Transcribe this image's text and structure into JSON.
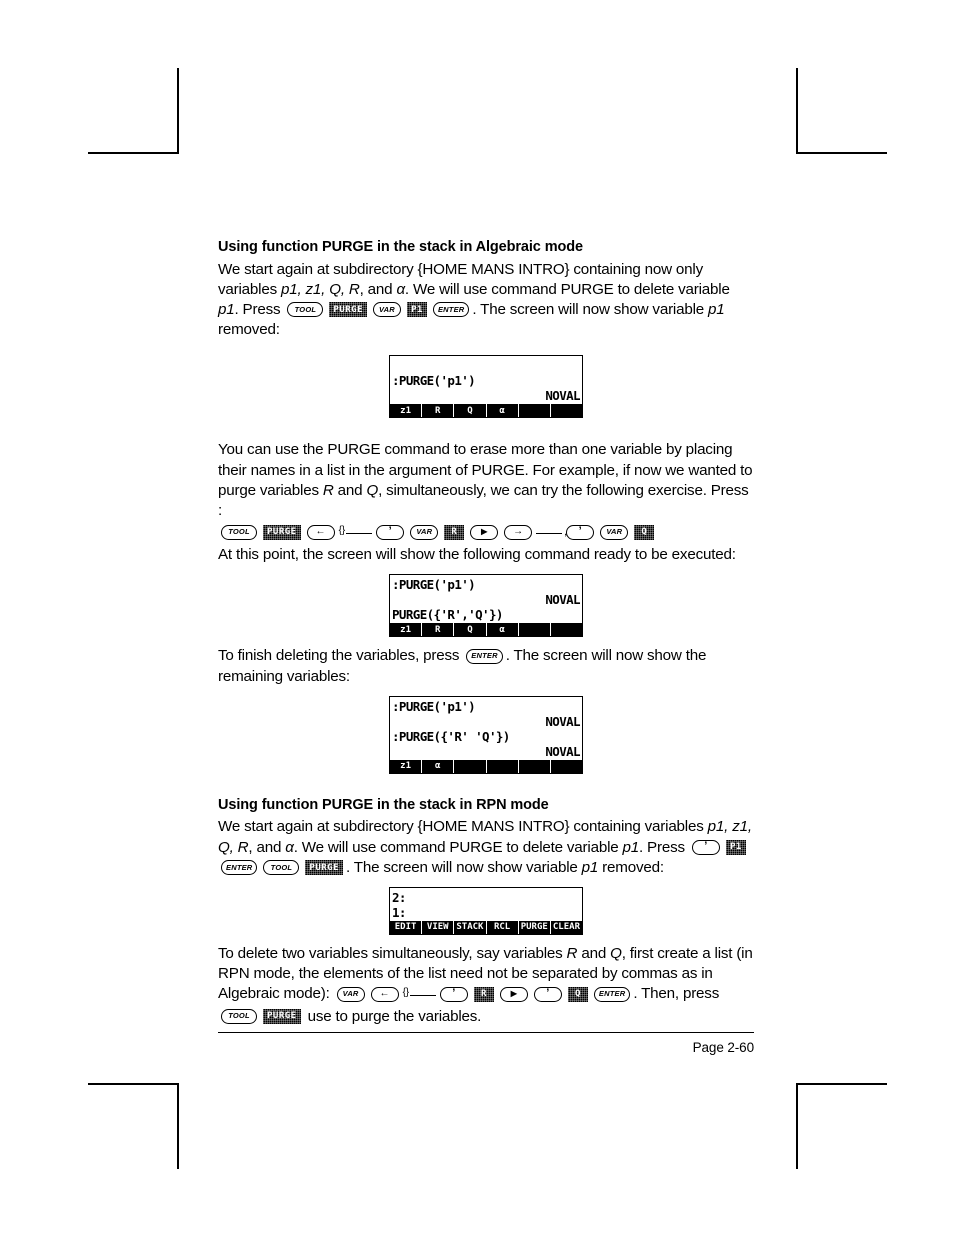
{
  "page": {
    "footer_label": "Page 2-60"
  },
  "sections": {
    "algebraic": {
      "heading": "Using function PURGE in the stack in Algebraic mode",
      "p1_a": "We start again at subdirectory {HOME MANS INTRO} containing now only variables ",
      "p1_vars": "p1, z1, Q, R",
      "p1_b": ", and ",
      "p1_alpha": "α",
      "p1_c": ".  We will use command PURGE to delete variable ",
      "p1_var": "p1",
      "p1_d": ".   Press ",
      "p1_e": ".   The screen will now show variable ",
      "p1_var2": "p1",
      "p1_f": " removed:",
      "keys1": [
        {
          "type": "key",
          "label": "TOOL",
          "name": "tool-key"
        },
        {
          "type": "softkey",
          "label": "PURGE",
          "name": "purge-softkey"
        },
        {
          "type": "key",
          "label": "VAR",
          "name": "var-key"
        },
        {
          "type": "softkey",
          "label": "P1",
          "name": "p1-softkey"
        },
        {
          "type": "key",
          "label": "ENTER",
          "name": "enter-key"
        }
      ],
      "p2_a": "You can use the PURGE command to erase more than one variable by placing their names in a list in the argument of PURGE.  For example, if now we wanted to purge variables ",
      "p2_R": "R",
      "p2_b": " and ",
      "p2_Q": "Q",
      "p2_c": ", simultaneously, we can try the following exercise.  Press :",
      "keys2": [
        {
          "type": "key",
          "label": "TOOL",
          "name": "tool-key"
        },
        {
          "type": "softkey",
          "label": "PURGE",
          "name": "purge-softkey"
        },
        {
          "type": "arrowkey",
          "label": "left-arrow",
          "name": "left-shift-key",
          "annot": "{}"
        },
        {
          "type": "key",
          "label": "'",
          "name": "tick-key"
        },
        {
          "type": "key",
          "label": "VAR",
          "name": "var-key"
        },
        {
          "type": "softkey",
          "label": "R",
          "name": "r-softkey"
        },
        {
          "type": "arrowkey",
          "label": "right-triangle",
          "name": "right-cursor-key"
        },
        {
          "type": "arrowkey",
          "label": "right-arrow",
          "name": "right-shift-key",
          "annot": ","
        },
        {
          "type": "key",
          "label": "'",
          "name": "tick-key"
        },
        {
          "type": "key",
          "label": "VAR",
          "name": "var-key"
        },
        {
          "type": "softkey",
          "label": "Q",
          "name": "q-softkey"
        }
      ],
      "p3": "At this point, the screen will show the following command ready to be executed:",
      "p4_a": "To finish deleting the variables, press ",
      "p4_enter": "ENTER",
      "p4_b": ".   The screen will now show the remaining variables:"
    },
    "rpn": {
      "heading": "Using function PURGE in the stack in RPN mode",
      "p1_a": "We start again at subdirectory {HOME MANS INTRO} containing variables ",
      "p1_vars": "p1, z1, Q, R",
      "p1_b": ", and ",
      "p1_alpha": "α",
      "p1_c": ".  We will use command PURGE to delete variable ",
      "p1_var": "p1",
      "p1_d": ".  Press ",
      "p1_e": ".   The screen will now show variable ",
      "p1_var2": "p1",
      "p1_f": " removed:",
      "keys1": [
        {
          "type": "key",
          "label": "'",
          "name": "tick-key"
        },
        {
          "type": "softkey",
          "label": "P1",
          "name": "p1-softkey"
        },
        {
          "type": "key",
          "label": "ENTER",
          "name": "enter-key"
        },
        {
          "type": "key",
          "label": "TOOL",
          "name": "tool-key"
        },
        {
          "type": "softkey",
          "label": "PURGE",
          "name": "purge-softkey"
        }
      ],
      "p2_a": "To delete two variables simultaneously, say variables ",
      "p2_R": "R",
      "p2_b": " and ",
      "p2_Q": "Q",
      "p2_c": ", first create a list (in RPN mode, the elements of the list need not be separated by commas as in Algebraic mode):  ",
      "p2_d": ".  Then, press ",
      "p2_e": " use to purge the variables.",
      "keys2": [
        {
          "type": "key",
          "label": "VAR",
          "name": "var-key"
        },
        {
          "type": "arrowkey",
          "label": "left-arrow",
          "name": "left-shift-key",
          "annot": "{}"
        },
        {
          "type": "key",
          "label": "'",
          "name": "tick-key"
        },
        {
          "type": "softkey",
          "label": "R",
          "name": "r-softkey"
        },
        {
          "type": "arrowkey",
          "label": "right-triangle",
          "name": "right-cursor-key"
        },
        {
          "type": "key",
          "label": "'",
          "name": "tick-key"
        },
        {
          "type": "softkey",
          "label": "Q",
          "name": "q-softkey"
        },
        {
          "type": "key",
          "label": "ENTER",
          "name": "enter-key"
        }
      ],
      "keys3": [
        {
          "type": "key",
          "label": "TOOL",
          "name": "tool-key"
        },
        {
          "type": "softkey",
          "label": "PURGE",
          "name": "purge-softkey"
        }
      ]
    }
  },
  "screens": [
    {
      "id": "screen-1",
      "lines": [
        {
          "left": "",
          "right": ""
        },
        {
          "left": ":PURGE('p1')",
          "right": ""
        },
        {
          "left": "",
          "right": "NOVAL"
        }
      ],
      "cmdline": "",
      "menu": [
        "z1",
        "R",
        "Q",
        "α",
        "",
        ""
      ]
    },
    {
      "id": "screen-2",
      "lines": [
        {
          "left": ":PURGE('p1')",
          "right": ""
        },
        {
          "left": "",
          "right": "NOVAL"
        }
      ],
      "cmdline": "PURGE({'R','Q'})",
      "menu": [
        "z1",
        "R",
        "Q",
        "α",
        "",
        ""
      ]
    },
    {
      "id": "screen-3",
      "lines": [
        {
          "left": ":PURGE('p1')",
          "right": ""
        },
        {
          "left": "",
          "right": "NOVAL"
        },
        {
          "left": ":PURGE({'R' 'Q'})",
          "right": ""
        },
        {
          "left": "",
          "right": "NOVAL"
        }
      ],
      "cmdline": "",
      "menu": [
        "z1",
        "α",
        "",
        "",
        "",
        ""
      ]
    },
    {
      "id": "screen-4",
      "lines": [
        {
          "left": "2:",
          "right": ""
        },
        {
          "left": "1:",
          "right": ""
        }
      ],
      "cmdline": "",
      "menu": [
        "EDIT",
        "VIEW",
        "STACK",
        "RCL",
        "PURGE",
        "CLEAR"
      ]
    }
  ]
}
